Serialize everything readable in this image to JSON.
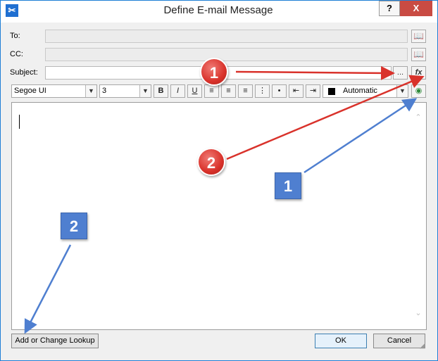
{
  "window": {
    "title": "Define E-mail Message",
    "help_glyph": "?",
    "close_glyph": "X"
  },
  "fields": {
    "to_label": "To:",
    "cc_label": "CC:",
    "subject_label": "Subject:",
    "to_value": "",
    "cc_value": "",
    "subject_value": "",
    "ellipsis_label": "...",
    "function_label": "fx"
  },
  "toolbar": {
    "font_name": "Segoe UI",
    "font_size": "3",
    "bold": "B",
    "italic": "I",
    "underline": "U",
    "color_name": "Automatic",
    "color_swatch": "#000000"
  },
  "buttons": {
    "lookup": "Add or Change Lookup",
    "ok": "OK",
    "cancel": "Cancel"
  },
  "annotations": {
    "red_1": "1",
    "red_2": "2",
    "blue_1": "1",
    "blue_2": "2",
    "red_color": "#d9322b",
    "blue_color": "#4f7fd0"
  }
}
